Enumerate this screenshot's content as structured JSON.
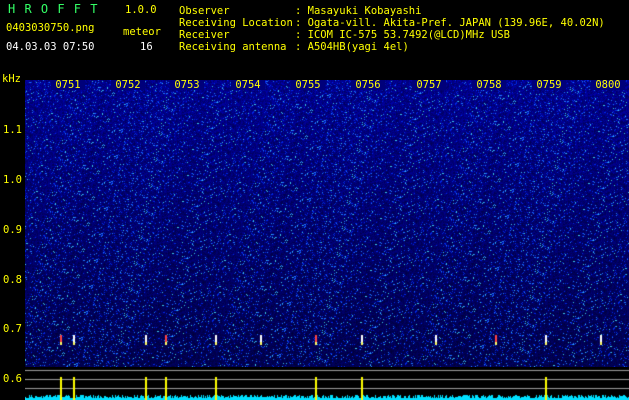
{
  "app": {
    "title": "H R O F F T",
    "version": "1.0.0"
  },
  "file": {
    "name": "0403030750.png",
    "datetime": "04.03.03 07:50"
  },
  "meteor": {
    "label": "meteor",
    "count": "16"
  },
  "info": [
    {
      "label": "Observer",
      "value": ": Masayuki Kobayashi"
    },
    {
      "label": "Receiving Location",
      "value": ": Ogata-vill. Akita-Pref. JAPAN (139.96E, 40.02N)"
    },
    {
      "label": "Receiver",
      "value": ": ICOM IC-575 53.7492(@LCD)MHz USB"
    },
    {
      "label": "Receiving antenna",
      "value": ": A504HB(yagi 4el)"
    }
  ],
  "axis": {
    "unit": "kHz",
    "y_ticks": [
      "1.1",
      "1.0",
      "0.9",
      "0.8",
      "0.7",
      "0.6"
    ],
    "x_ticks": [
      "0751",
      "0752",
      "0753",
      "0754",
      "0755",
      "0756",
      "0757",
      "0758",
      "0759",
      "0800"
    ]
  },
  "colors": {
    "label": "#ffff00",
    "accent": "#33ff66",
    "background": "#000000",
    "spectrum": "#00007a"
  }
}
